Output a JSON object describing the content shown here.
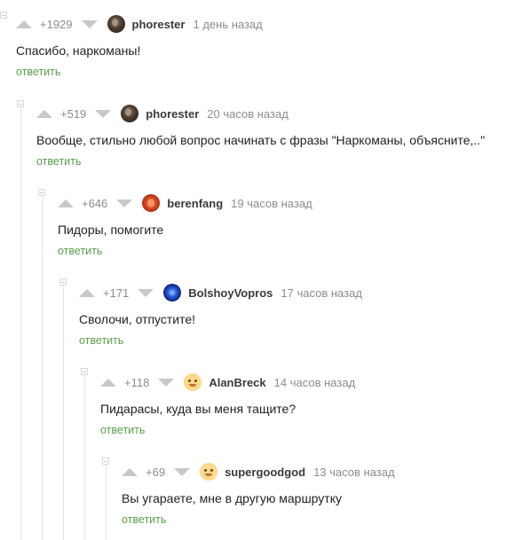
{
  "reply_label": "ответить",
  "comments": [
    {
      "rating": "+1929",
      "author": "phorester",
      "time": "1 день назад",
      "text": "Спасибо, наркоманы!",
      "avatar": "phorester-avatar"
    },
    {
      "rating": "+519",
      "author": "phorester",
      "time": "20 часов назад",
      "text": "Вообще, стильно любой вопрос начинать с фразы \"Наркоманы, объясните,..\"",
      "avatar": "phorester-avatar"
    },
    {
      "rating": "+646",
      "author": "berenfang",
      "time": "19 часов назад",
      "text": "Пидоры, помогите",
      "avatar": "berenfang-avatar"
    },
    {
      "rating": "+171",
      "author": "BolshoyVopros",
      "time": "17 часов назад",
      "text": "Сволочи, отпустите!",
      "avatar": "bolshoyvopros-avatar"
    },
    {
      "rating": "+118",
      "author": "AlanBreck",
      "time": "14 часов назад",
      "text": "Пидарасы, куда вы меня тащите?",
      "avatar": "alanbreck-avatar"
    },
    {
      "rating": "+69",
      "author": "supergoodgod",
      "time": "13 часов назад",
      "text": "Вы угараете, мне в другую маршрутку",
      "avatar": "supergoodgod-avatar"
    }
  ],
  "colors": {
    "reply": "#5a9e4b",
    "meta": "#8c8c8c",
    "arrow": "#c8c8c8",
    "thread": "#e4e4e4"
  }
}
